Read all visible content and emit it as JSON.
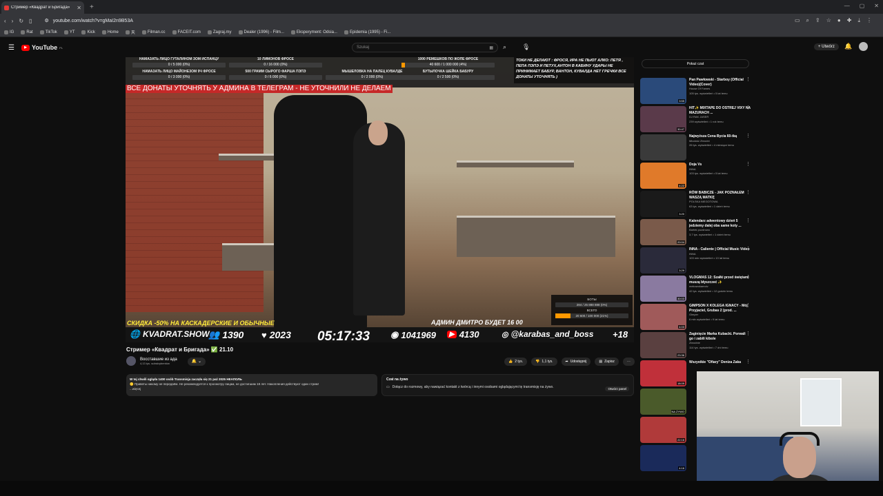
{
  "browser": {
    "tab_title": "Стример «Квадрат и Бригада»",
    "url": "youtube.com/watch?v=gMaI2n9B53A"
  },
  "bookmarks": [
    "IG",
    "Rat",
    "TikTok",
    "YT",
    "Kick",
    "Home",
    "天",
    "Filman.cc",
    "FACEIT.com",
    "Zagraj.my",
    "Dealer (1996) - Film...",
    "Eksperyment: Odsia...",
    "Epidemia (1995) - Fi..."
  ],
  "youtube": {
    "logo": "YouTube",
    "region": "PL",
    "search_placeholder": "Szukaj",
    "create_label": "Utwórz"
  },
  "stream": {
    "goals": [
      {
        "label": "НАМАЗАТЬ ЛИЦО ГУТАЛИНОМ ЗОМ ИСПАНЦУ",
        "progress": "0 / 5 000 (0%)"
      },
      {
        "label": "10 ЛИМОНОВ ФРОСЕ",
        "progress": "0 / 16 000 (0%)"
      },
      {
        "label": "НАМАЗАТЬ ЛИЦО МАЙОНЕЗОМ 9Ч ФРОСЕ",
        "progress": "0 / 3 000 (0%)"
      },
      {
        "label": "500 ГРАММ СЫРОГО ФАРША ПЭПЭ",
        "progress": "0 / 6 000 (0%)"
      },
      {
        "label": "МЫШЕЛОВКА НА ПАЛЕЦ КУВАЛДЕ",
        "progress": "0 / 2 000 (0%)"
      },
      {
        "label": "1000 РЕМЕШКОВ ПО ЖОПЕ ФРОСЕ",
        "progress": "40 600 / 1 000 000 (4%)",
        "fill": 0.04
      },
      {
        "label": "БУТЫЛОЧКА ШЕЙКА БАБУРУ",
        "progress": "0 / 2 500 (0%)"
      }
    ],
    "red_banner": "ВСЕ ДОНАТЫ УТОЧНЯТЬ У АДМИНА В ТЕЛЕГРАМ - НЕ УТОЧНИЛИ НЕ ДЕЛАЕМ",
    "right_text": "ТОКИ НЕ ДЕЛАЮТ : ФРОСЯ, ИРА НЕ ПЬЮТ АЛКО: ПЕТЯ , ПЕПА ПЭПЭ И ПЕТУХ,АНТОН В КАБИНУ УДАРЫ НЕ ПРИНИМАЕТ БАБУР, ВАНТОН, КУВАЛДА НЕТ ГРЕЧКИ ВСЕ ДОНАТЫ УТОЧНЯТЬ )",
    "yellow_text": "СКИДКА -50% НА КАСКАДЕРСКИЕ И ОБЫЧНЫЕ",
    "admin_text": "АДМИН ДМИТРО БУДЕТ 16 00",
    "donbox": {
      "label1": "БОТЫ",
      "val1": "284 / 25 888 888 (0%)",
      "label2": "ВСЕГО",
      "val2": "20 600 / 100 000 (21%)",
      "fill2": 0.21
    },
    "bar": {
      "site": "KVADRAT.SHOW",
      "viewers": "1390",
      "likes": "2023",
      "timer": "05:17:33",
      "views": "1041969",
      "yt": "4130",
      "handle": "@karabas_and_boss",
      "age": "+18"
    }
  },
  "video": {
    "title": "Стример «Квадрат и Бригада»",
    "title_suffix": "21.10",
    "channel": "Восставшие из ада",
    "subs": "4,13 tys. subskrybentów",
    "likes": "2 tys.",
    "dislikes": "1,1 tys.",
    "share": "Udostępnij",
    "save": "Zapisz"
  },
  "description": {
    "line1": "W tej chwili ogląda 1400 osób  Transmisja zaczęła się 21 paź 2025  НЕАПОЛЬ",
    "line2": "🟡 Приветы никому не передаём. Не рекомендуется к просмотру лицам, не достигшим 18 лет. Накопления действуют один стрим!",
    "more": "...więcej"
  },
  "chat": {
    "title": "Czat na żywo",
    "text": "Dołącz do rozmowy, aby nawiązać kontakt z twórcą i innymi osobami oglądającymi tę transmisję na żywo.",
    "open": "Otwórz panel",
    "show": "Pokaż czat"
  },
  "recommended": [
    {
      "title": "Pan Pawłowski - Starboy (Official Video)(Cover)",
      "channel": "House Of Fames",
      "meta": "105 tys. wyświetleń • 5 lat temu",
      "dur": "3:55",
      "color": "#2a4a7a"
    },
    {
      "title": "HIT✨ MIXTAPE DO OSTREJ VIXY NA MAZURACH ...",
      "channel": "DJ RAK JASER",
      "meta": "239 wyświetleń • 1 rok temu",
      "dur": "30:47",
      "color": "#5a3a4a"
    },
    {
      "title": "Najwyższa Cena Bycia 60-tką",
      "channel": "Młodość Zbrodni",
      "meta": "26 tys. wyświetleń • 4 miesiące temu",
      "dur": "",
      "color": "#3a3a3a"
    },
    {
      "title": "Doja Vs",
      "channel": "INNA",
      "meta": "103 tys. wyświetleń • 5 lat temu",
      "dur": "4:22",
      "color": "#e07a2a"
    },
    {
      "title": "RÓW BABICZE - JAK POZNAŁEM WASZĄ MATKĘ",
      "channel": "POLSKA NIEGOTOWA",
      "meta": "63 tys. wyświetleń • 1 dzień temu",
      "dur": "3:20",
      "color": "#1a1a1a"
    },
    {
      "title": "Kalendarz adwentowy dzień 5 jedziemy dalej oba same koty ...",
      "channel": "Bartek pozdrowo",
      "meta": "3,7 tys. wyświetleń • 1 dzień temu",
      "dur": "20:04",
      "color": "#7a5a4a"
    },
    {
      "title": "INNA - Caliente | Official Music Video",
      "channel": "INNA",
      "meta": "103 mln wyświetleń • 13 lat temu",
      "dur": "3:29",
      "color": "#2a2a3a"
    },
    {
      "title": "VLOGMAS 12: Szałki przed świętami muszą błyszczeć ✨",
      "channel": "mekowokamoiv",
      "meta": "42 tys. wyświetleń • 12 godzin temu",
      "dur": "30:03",
      "color": "#8a7aa0"
    },
    {
      "title": "GIMPSON X KOLEGA IGNACY - Mój Przyjaciel, Grubas 2 (prod. ...",
      "channel": "Gimper",
      "meta": "6 mln wyświetleń • 9 lat temu",
      "dur": "4:03",
      "color": "#a05a5a"
    },
    {
      "title": "Zaginięcie Marka Kubacki. Porwali go i zabili kibole",
      "channel": "Zbrodnie",
      "meta": "114 tys. wyświetleń • 7 dni temu",
      "dur": "23:36",
      "color": "#5a4040"
    },
    {
      "title": "Wszystkie \"Ofiary\" Deniza Zaka",
      "channel": "",
      "meta": "",
      "dur": "18:09",
      "color": "#c0303a"
    },
    {
      "title": "",
      "channel": "",
      "meta": "",
      "dur": "NA ŻYWO",
      "color": "#4a5a2a"
    },
    {
      "title": "",
      "channel": "",
      "meta": "",
      "dur": "22:16",
      "color": "#b03a3a"
    },
    {
      "title": "",
      "channel": "",
      "meta": "",
      "dur": "4:16",
      "color": "#1a2a5a"
    }
  ]
}
